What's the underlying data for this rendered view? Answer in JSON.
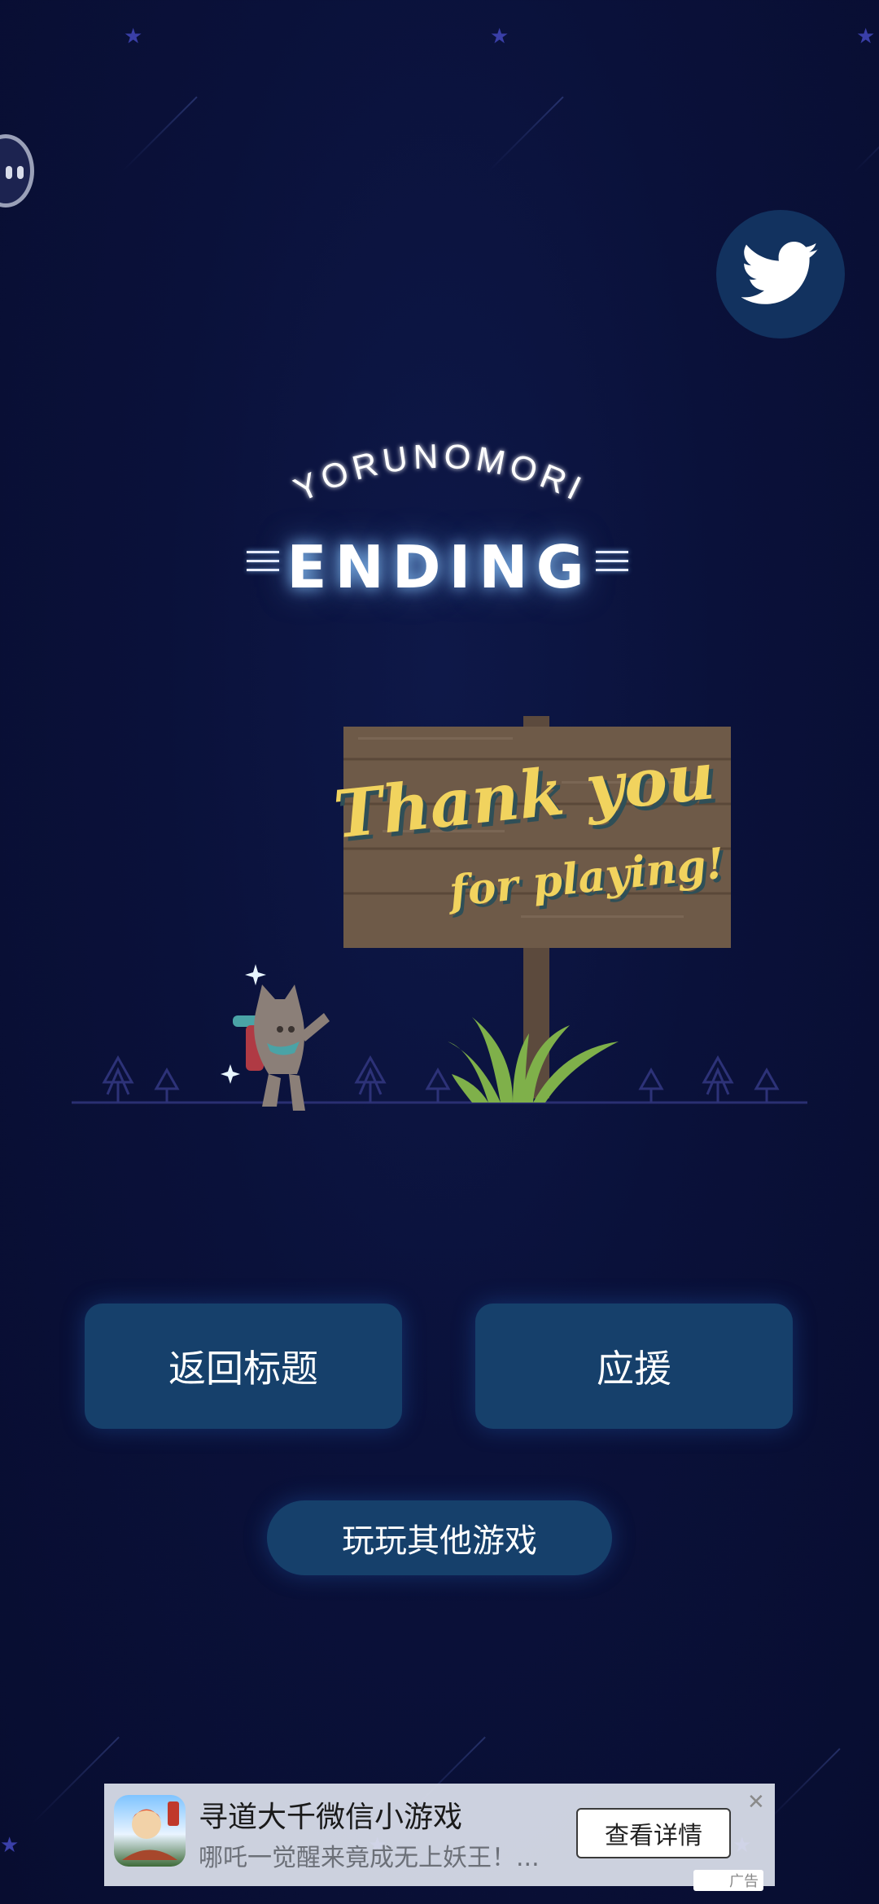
{
  "title": {
    "arc_text": "YORUNOMORI",
    "main": "ENDING"
  },
  "sign": {
    "line1": "Thank you",
    "line2": "for playing!"
  },
  "buttons": {
    "back_to_title": "返回标题",
    "support": "应援",
    "other_games": "玩玩其他游戏"
  },
  "ad": {
    "title": "寻道大千微信小游戏",
    "subtitle": "哪吒一觉醒来竟成无上妖王！...",
    "cta": "查看详情",
    "close": "✕",
    "badge": "广告"
  },
  "icons": {
    "twitter": "twitter-bird-icon",
    "side": "floating-handle-icon"
  },
  "colors": {
    "background": "#0a113a",
    "button": "#16406b",
    "twitter_circle": "#12325f",
    "sign_wood": "#6e5a48",
    "sign_text": "#f1d35e",
    "grass": "#7fb04a"
  }
}
